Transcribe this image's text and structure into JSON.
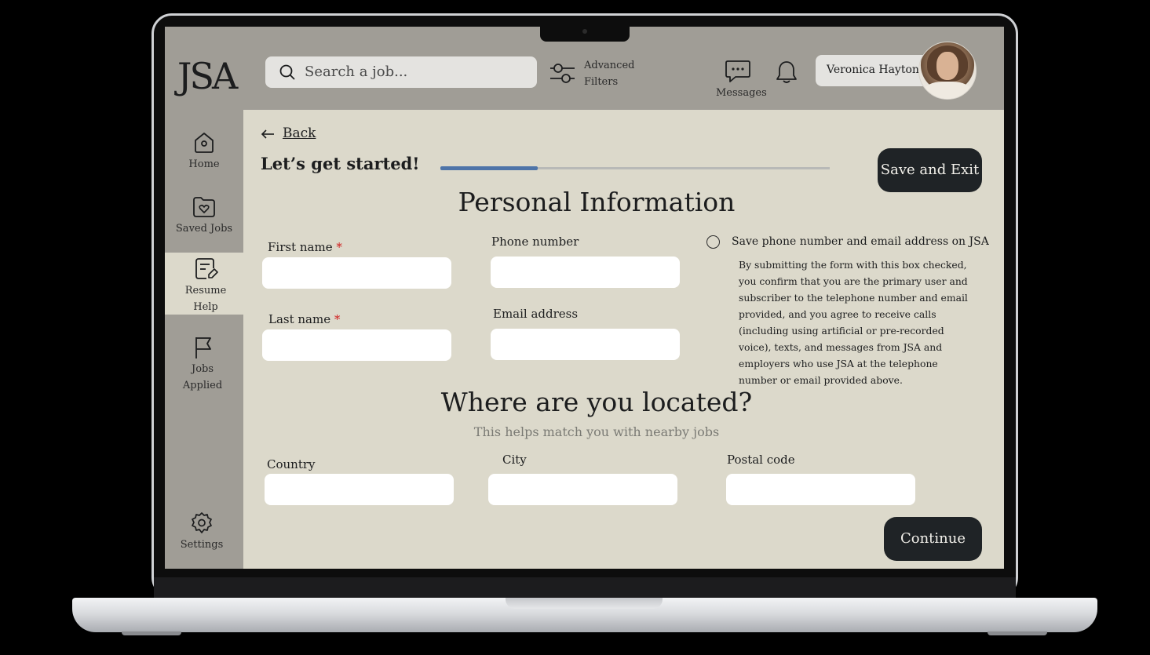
{
  "app": {
    "logo": "JSA"
  },
  "header": {
    "search_placeholder": "Search a job...",
    "advanced_filters_line1": "Advanced",
    "advanced_filters_line2": "Filters",
    "messages_label": "Messages",
    "user_name": "Veronica Hayton"
  },
  "sidebar": {
    "items": [
      {
        "label": "Home",
        "icon": "home-icon"
      },
      {
        "label": "Saved Jobs",
        "icon": "folder-heart-icon"
      },
      {
        "label_line1": "Resume",
        "label_line2": "Help",
        "icon": "resume-edit-icon",
        "active": true
      },
      {
        "label_line1": "Jobs",
        "label_line2": "Applied",
        "icon": "flag-icon"
      },
      {
        "label": "Settings",
        "icon": "gear-icon"
      }
    ]
  },
  "main": {
    "back_label": "Back",
    "start_title": "Let’s get started!",
    "progress_fraction": 0.25,
    "save_exit_label": "Save and Exit",
    "personal_heading": "Personal Information",
    "fields": {
      "first_name": {
        "label": "First name",
        "required_mark": "*",
        "value": ""
      },
      "last_name": {
        "label": "Last name",
        "required_mark": "*",
        "value": ""
      },
      "phone": {
        "label": "Phone number",
        "value": ""
      },
      "email": {
        "label": "Email address",
        "value": ""
      },
      "country": {
        "label": "Country",
        "value": ""
      },
      "city": {
        "label": "City",
        "value": ""
      },
      "postal": {
        "label": "Postal code",
        "value": ""
      }
    },
    "consent": {
      "checked": false,
      "title": "Save phone number and email address on JSA",
      "body": "By submitting the form with this box checked, you confirm that you are the primary user and subscriber to the telephone number and email provided, and you agree to receive calls (including using artificial or pre-recorded voice), texts, and messages from JSA and employers who use JSA at the telephone number or email provided above."
    },
    "location_heading": "Where are you located?",
    "location_sub": "This helps match you with nearby jobs",
    "continue_label": "Continue"
  },
  "colors": {
    "accent": "#4e74a8",
    "panel": "#dcd9cb",
    "chrome": "#a09d96",
    "button": "#1f2326",
    "required": "#d01f1f"
  }
}
